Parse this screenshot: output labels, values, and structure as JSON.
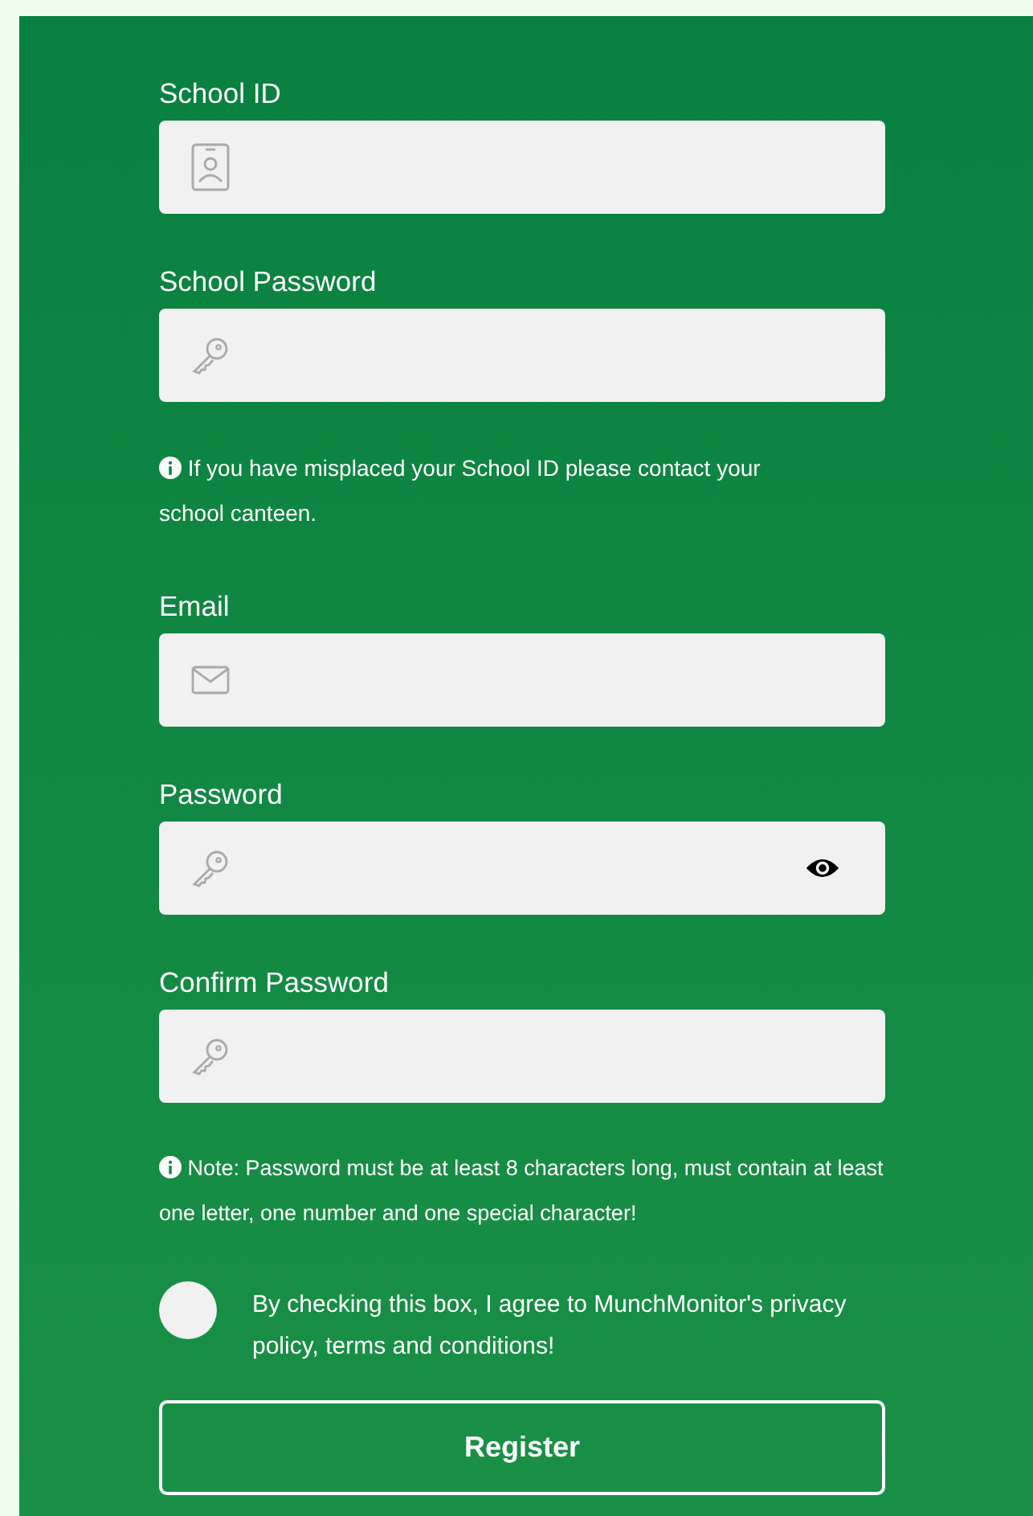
{
  "school_fields": [
    {
      "label": "School ID",
      "kind": "id"
    },
    {
      "label": "School Password",
      "kind": "key"
    }
  ],
  "school_note": "If you have misplaced your School ID please contact your school canteen.",
  "account_fields": [
    {
      "label": "Email",
      "kind": "mail"
    },
    {
      "label": "Password",
      "kind": "password"
    },
    {
      "label": "Confirm Password",
      "kind": "key"
    }
  ],
  "password_note": "Note: Password must be at least 8 characters long, must contain at least one letter, one number and one special character!",
  "agreement": {
    "checked": false,
    "text": "By checking this box, I agree to MunchMonitor's privacy policy, terms and conditions!"
  },
  "submit_button": "Register"
}
